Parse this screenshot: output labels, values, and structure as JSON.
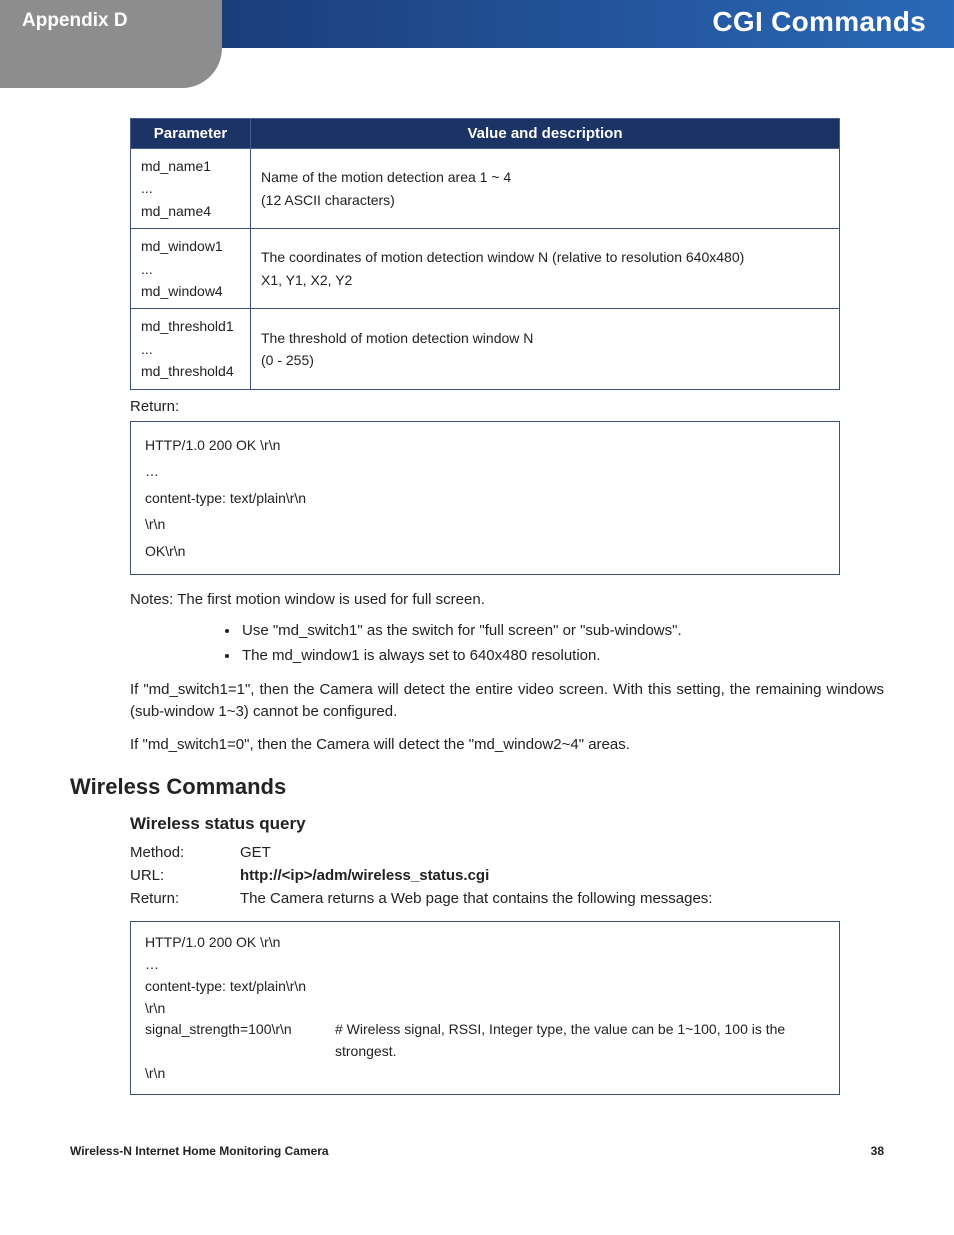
{
  "header": {
    "left": "Appendix D",
    "right": "CGI Commands"
  },
  "table": {
    "head": {
      "param": "Parameter",
      "desc": "Value and description"
    },
    "rows": [
      {
        "param": "md_name1\n...\nmd_name4",
        "desc": "Name of the motion detection area 1 ~ 4\n(12 ASCII characters)"
      },
      {
        "param": "md_window1\n...\nmd_window4",
        "desc": "The coordinates of motion detection window N (relative to resolution 640x480)\nX1, Y1, X2, Y2"
      },
      {
        "param": "md_threshold1\n...\nmd_threshold4",
        "desc": "The threshold of motion detection window N\n(0 - 255)"
      }
    ]
  },
  "returnLabel": "Return:",
  "codebox1": "HTTP/1.0 200 OK \\r\\n\n…\ncontent-type: text/plain\\r\\n\n\\r\\n\nOK\\r\\n",
  "notesLine": "Notes:  The first motion window is used for full screen.",
  "bullets": [
    "Use \"md_switch1\" as the switch for \"full screen\" or \"sub-windows\".",
    "The md_window1 is always set to 640x480 resolution."
  ],
  "para1": "If \"md_switch1=1\", then the Camera will detect the entire video screen. With this setting, the remaining windows (sub-window 1~3) cannot be configured.",
  "para2": "If \"md_switch1=0\", then the Camera will detect the \"md_window2~4\" areas.",
  "section": "Wireless Commands",
  "subsection": "Wireless status query",
  "kv": {
    "method": {
      "k": "Method:",
      "v": "GET"
    },
    "url": {
      "k": "URL:",
      "v": "http://<ip>/adm/wireless_status.cgi"
    },
    "ret": {
      "k": "Return:",
      "v": "The Camera returns a Web page that contains the following messages:"
    }
  },
  "codebox2": {
    "lines": [
      {
        "c1": "HTTP/1.0 200 OK \\r\\n",
        "c2": ""
      },
      {
        "c1": "…",
        "c2": ""
      },
      {
        "c1": "content-type: text/plain\\r\\n",
        "c2": ""
      },
      {
        "c1": "\\r\\n",
        "c2": ""
      },
      {
        "c1": "signal_strength=100\\r\\n",
        "c2": "# Wireless signal, RSSI, Integer type, the value can be 1~100, 100 is the strongest."
      },
      {
        "c1": "\\r\\n",
        "c2": ""
      }
    ]
  },
  "footer": {
    "left": "Wireless-N Internet Home Monitoring Camera",
    "right": "38"
  }
}
